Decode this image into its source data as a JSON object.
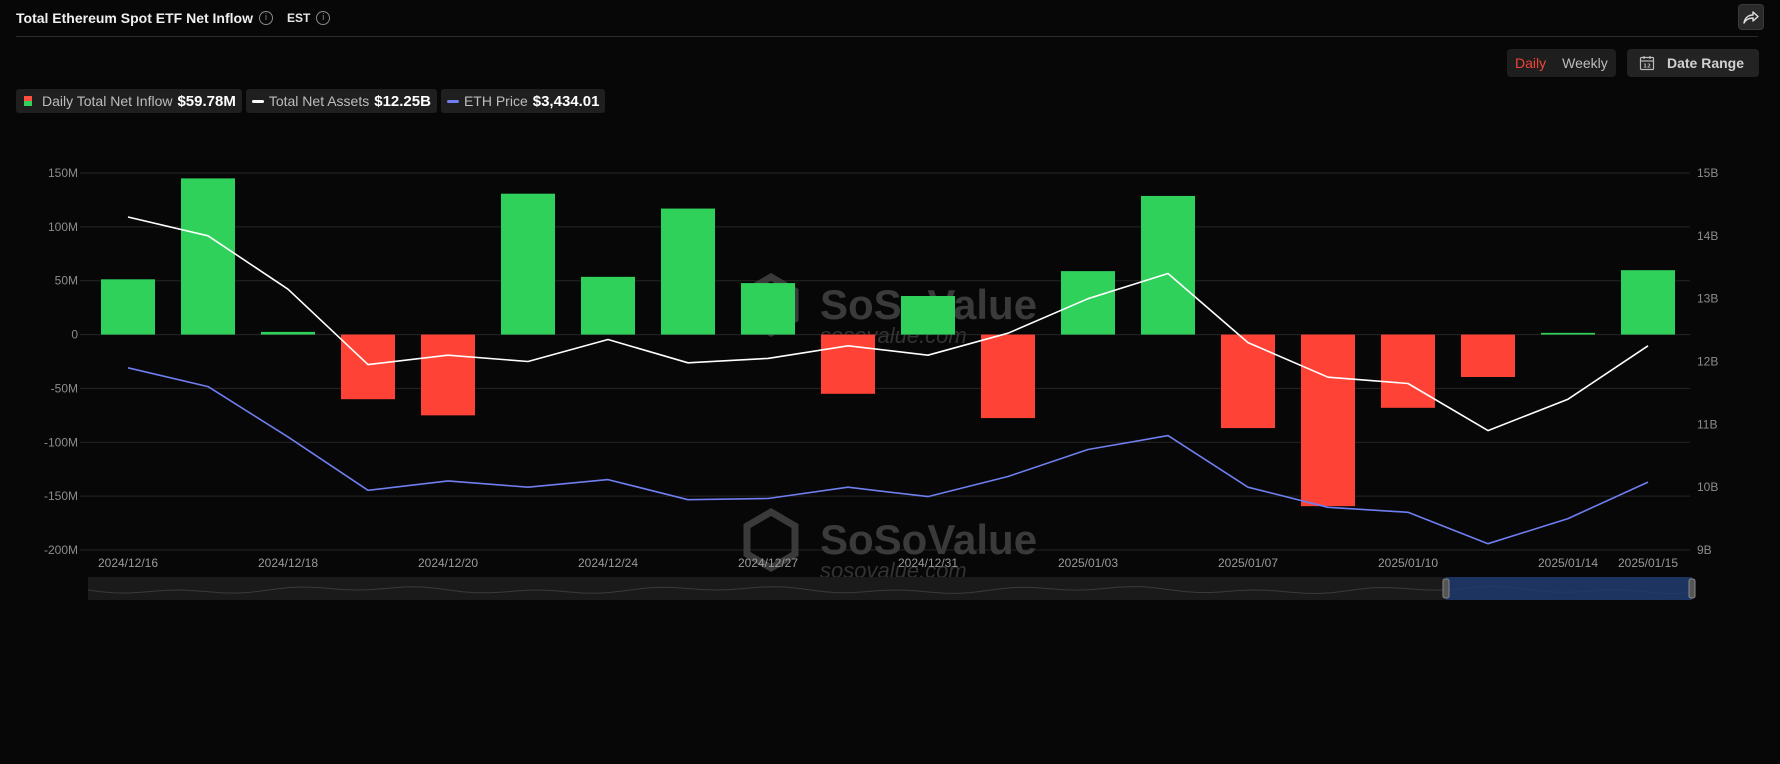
{
  "header": {
    "title": "Total Ethereum Spot ETF Net Inflow",
    "timezone": "EST"
  },
  "toggle": {
    "daily": "Daily",
    "weekly": "Weekly",
    "selected": "Daily"
  },
  "date_range_label": "Date Range",
  "legend": [
    {
      "label": "Daily Total Net Inflow",
      "value": "$59.78M"
    },
    {
      "label": "Total Net Assets",
      "value": "$12.25B"
    },
    {
      "label": "ETH Price",
      "value": "$3,434.01"
    }
  ],
  "watermark": {
    "brand": "SoSoValue",
    "url": "sosovalue.com"
  },
  "colors": {
    "inflow_positive": "#2fd15a",
    "inflow_negative": "#ff4236",
    "net_assets_line": "#ffffff",
    "eth_price_line": "#6f7ef0",
    "accent": "#f04438"
  },
  "chart_data": {
    "type": "bar",
    "left_axis": {
      "ticks": [
        "150M",
        "100M",
        "50M",
        "0",
        "-50M",
        "-100M",
        "-150M",
        "-200M"
      ],
      "range": [
        -200,
        150
      ],
      "unit": "M"
    },
    "right_axis": {
      "ticks": [
        "15B",
        "14B",
        "13B",
        "12B",
        "11B",
        "10B",
        "9B"
      ],
      "range": [
        9,
        15
      ],
      "unit": "B"
    },
    "x_tick_labels": [
      "2024/12/16",
      "2024/12/18",
      "2024/12/20",
      "2024/12/24",
      "2024/12/27",
      "2024/12/31",
      "2025/01/03",
      "2025/01/07",
      "2025/01/10",
      "2025/01/14",
      "2025/01/15"
    ],
    "x_tick_indices": [
      0,
      2,
      4,
      6,
      8,
      10,
      12,
      14,
      16,
      18,
      19
    ],
    "dates": [
      "2024/12/16",
      "2024/12/17",
      "2024/12/18",
      "2024/12/19",
      "2024/12/20",
      "2024/12/23",
      "2024/12/24",
      "2024/12/26",
      "2024/12/27",
      "2024/12/30",
      "2024/12/31",
      "2025/01/02",
      "2025/01/03",
      "2025/01/06",
      "2025/01/07",
      "2025/01/08",
      "2025/01/10",
      "2025/01/13",
      "2025/01/14",
      "2025/01/15"
    ],
    "series": [
      {
        "name": "Daily Total Net Inflow",
        "type": "bar",
        "axis": "left",
        "values": [
          51.3,
          145,
          2.5,
          -60,
          -75,
          130.8,
          53.6,
          117,
          47.8,
          -55,
          35.8,
          -77.5,
          58.9,
          128.7,
          -86.8,
          -159.3,
          -68,
          -39.4,
          1.6,
          59.78
        ]
      },
      {
        "name": "Total Net Assets",
        "type": "line",
        "axis": "right",
        "values": [
          14.3,
          14.0,
          13.15,
          11.95,
          12.1,
          12.0,
          12.35,
          11.98,
          12.05,
          12.25,
          12.1,
          12.45,
          13.0,
          13.4,
          12.3,
          11.75,
          11.65,
          10.9,
          11.4,
          12.25
        ]
      },
      {
        "name": "ETH Price",
        "type": "line",
        "axis": "right",
        "values": [
          11.9,
          11.6,
          10.8,
          9.95,
          10.1,
          10.0,
          10.12,
          9.8,
          9.82,
          10.0,
          9.85,
          10.17,
          10.6,
          10.82,
          10.0,
          9.68,
          9.6,
          9.1,
          9.5,
          10.08
        ]
      }
    ],
    "legend_position": "top-left",
    "grid": true
  }
}
